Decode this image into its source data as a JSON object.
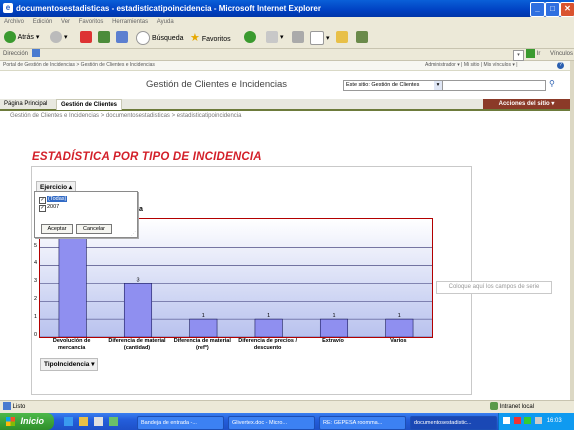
{
  "window": {
    "title": "documentosestadisticas - estadisticatipoincidencia - Microsoft Internet Explorer"
  },
  "menu": [
    "Archivo",
    "Edición",
    "Ver",
    "Favoritos",
    "Herramientas",
    "Ayuda"
  ],
  "toolbar": {
    "back_label": "Atrás",
    "search_label": "Búsqueda",
    "favorites_label": "Favoritos"
  },
  "address": {
    "label": "Dirección",
    "go_label": "Ir",
    "links_label": "Vínculos"
  },
  "sharepoint": {
    "top_breadcrumb": "Portal de Gestión de Incidencias > Gestión de Clientes e Incidencias",
    "user_links": "Administrador ▾ | Mi sitio | Mis vínculos ▾ |",
    "site_title": "Gestión de Clientes e Incidencias",
    "search_scope": "Este sitio: Gestión de Clientes",
    "tabs": [
      "Página Principal",
      "Gestión de Clientes"
    ],
    "actions_label": "Acciones del sitio ▾",
    "breadcrumb": "Gestión de Clientes e Incidencias > documentosestadisticas > estadisticatipoincidencia"
  },
  "report": {
    "title": "ESTADÍSTICA POR TIPO DE INCIDENCIA",
    "filter_field": "Ejercicio ▴",
    "filter_options": [
      {
        "label": "(Todas)",
        "checked": true
      },
      {
        "label": "2007",
        "checked": true
      }
    ],
    "filter_ok": "Aceptar",
    "filter_cancel": "Cancelar",
    "series_partial": "ia",
    "axis_field": "TipoIncidencia ▾",
    "drop_zone": "Coloque aquí los campos de serie"
  },
  "chart_data": {
    "type": "bar",
    "categories": [
      "Devolución de mercancía",
      "Diferencia de material (cantidad)",
      "Diferencia de material (refª)",
      "Diferencia de precios / descuento",
      "Extravío",
      "Varios"
    ],
    "values": [
      6,
      3,
      1,
      1,
      1,
      1
    ],
    "data_labels": [
      "",
      "3",
      "1",
      "1",
      "1",
      "1"
    ],
    "yticks": [
      "0",
      "1",
      "2",
      "3",
      "4",
      "5"
    ],
    "ylim": [
      0,
      6.6
    ],
    "bar_color": "#8f8ff0",
    "grid": true
  },
  "status": {
    "left": "Listo",
    "zone": "Intranet local"
  },
  "taskbar": {
    "start_label": "Inicio",
    "tasks": [
      "Bandeja de entrada -...",
      "Glivertex.doc - Micro...",
      "RE: GEPESA roomma...",
      "documentosestadistic..."
    ],
    "clock": "16:03"
  },
  "colors": {
    "title_red": "#d3202a",
    "chart_border": "#b30000",
    "actions_bg": "#8b3a28"
  }
}
